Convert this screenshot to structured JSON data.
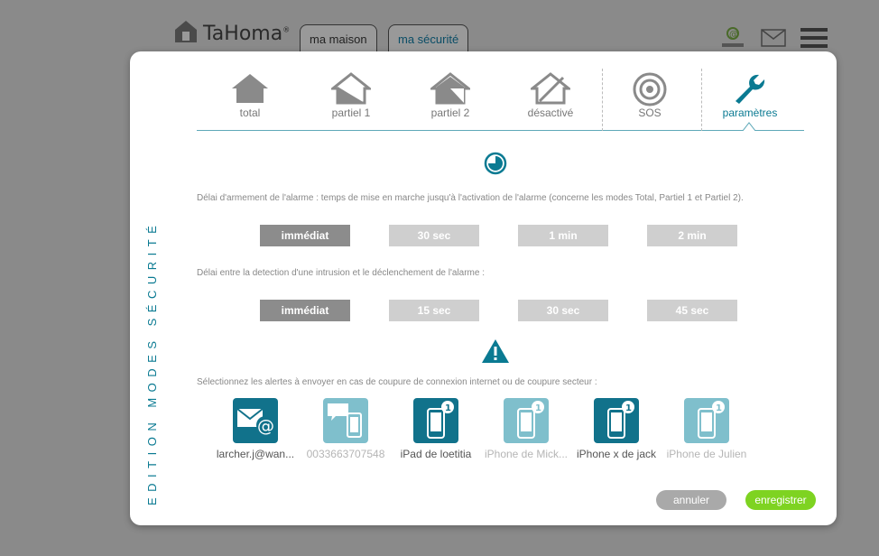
{
  "header": {
    "brand": "TaHoma",
    "brand_mark": "®",
    "nav": [
      {
        "label": "ma maison"
      },
      {
        "label": "ma sécurité"
      }
    ],
    "icons": [
      "user-at-icon",
      "mail-icon",
      "menu-icon"
    ]
  },
  "modal": {
    "side_title": "EDITION MODES SÉCURITÉ",
    "tabs": [
      {
        "label": "total",
        "icon": "house-full-icon"
      },
      {
        "label": "partiel 1",
        "icon": "house-partial-1-icon"
      },
      {
        "label": "partiel 2",
        "icon": "house-partial-2-icon"
      },
      {
        "label": "désactivé",
        "icon": "house-off-icon"
      },
      {
        "label": "SOS",
        "icon": "target-icon"
      },
      {
        "label": "paramètres",
        "icon": "wrench-icon",
        "active": true
      }
    ],
    "arming": {
      "description": "Délai d'armement de l'alarme : temps de mise en marche jusqu'à l'activation de l'alarme (concerne les modes Total, Partiel 1 et Partiel 2).",
      "options": [
        "immédiat",
        "30 sec",
        "1 min",
        "2 min"
      ],
      "selected": "immédiat"
    },
    "intrusion": {
      "description": "Délai entre la detection d'une intrusion et le déclenchement de l'alarme :",
      "options": [
        "immédiat",
        "15 sec",
        "30 sec",
        "45 sec"
      ],
      "selected": "immédiat"
    },
    "alerts": {
      "description": "Sélectionnez les alertes à envoyer en cas de coupure de connexion internet ou de coupure secteur :",
      "items": [
        {
          "label": "larcher.j@wan...",
          "type": "email",
          "enabled": true
        },
        {
          "label": "0033663707548",
          "type": "sms",
          "enabled": false
        },
        {
          "label": "iPad de loetitia",
          "type": "device",
          "badge": "1",
          "enabled": true
        },
        {
          "label": "iPhone de Mick...",
          "type": "device",
          "badge": "1",
          "enabled": false
        },
        {
          "label": "iPhone x de jack",
          "type": "device",
          "badge": "1",
          "enabled": true
        },
        {
          "label": "iPhone de Julien",
          "type": "device",
          "badge": "1",
          "enabled": false
        }
      ]
    },
    "buttons": {
      "cancel": "annuler",
      "save": "enregistrer"
    }
  },
  "colors": {
    "accent": "#0a7a92",
    "selected_option": "#8c8c8c",
    "option": "#cfcfcf",
    "save": "#7ed321",
    "cancel": "#a9a9a9"
  }
}
